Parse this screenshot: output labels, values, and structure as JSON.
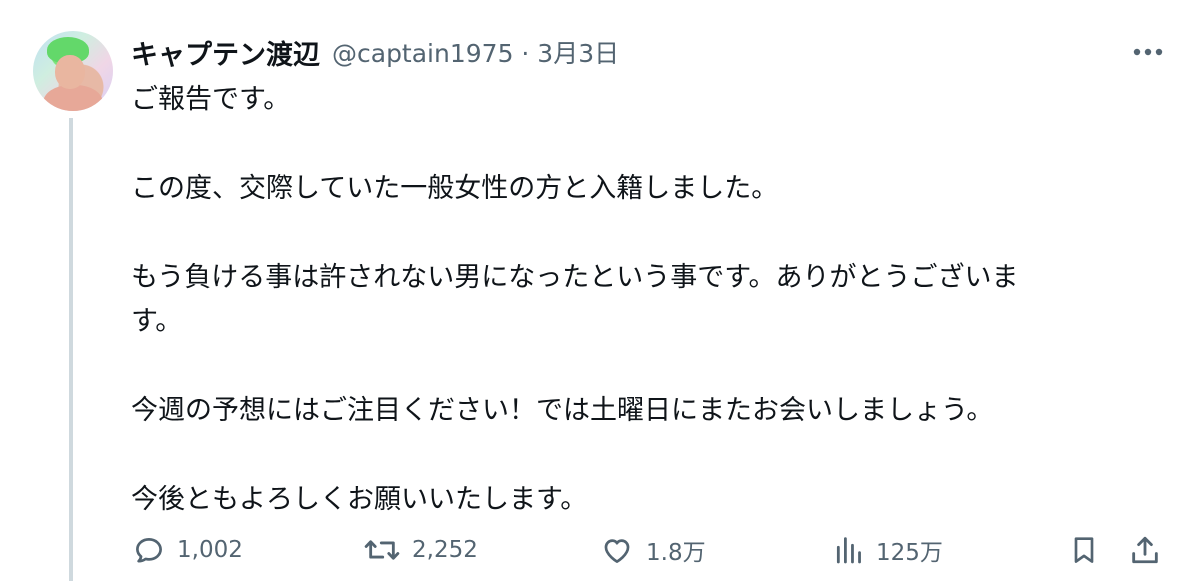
{
  "tweet": {
    "author": {
      "display_name": "キャプテン渡辺",
      "handle_and_date": "@captain1975 · 3月3日"
    },
    "body_paragraphs": [
      "ご報告です。",
      "",
      "この度、交際していた一般女性の方と入籍しました。",
      "",
      "もう負ける事は許されない男になったという事です。ありがとうございま",
      "す。",
      "",
      "今週の予想にはご注目ください！では土曜日にまたお会いしましょう。",
      "",
      "今後ともよろしくお願いいたします。"
    ],
    "stats": {
      "replies": "1,002",
      "retweets": "2,252",
      "likes": "1.8万",
      "views": "125万"
    }
  },
  "icons": {
    "more": "more-horizontal-icon",
    "reply": "reply-bubble-icon",
    "retweet": "retweet-icon",
    "like": "heart-icon",
    "views": "bar-chart-icon",
    "bookmark": "bookmark-icon",
    "share": "share-upload-icon"
  },
  "colors": {
    "text": "#0f1419",
    "secondary": "#536471",
    "thread_line": "#cfd9de"
  }
}
